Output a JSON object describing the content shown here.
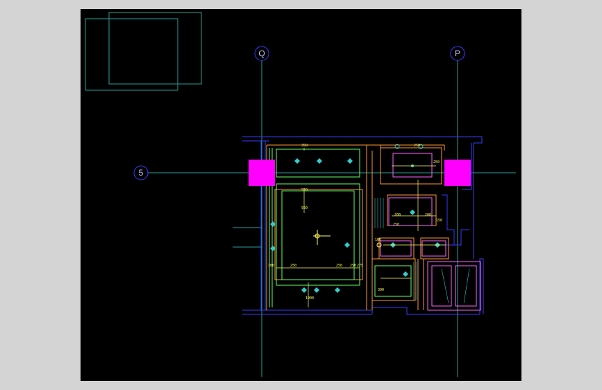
{
  "grid_labels": {
    "q": "Q",
    "p": "P",
    "row5": "5"
  },
  "dimensions": {
    "top_350": "350",
    "top_250a": "250",
    "top_250b": "250",
    "side_550": "550",
    "side_950": "950",
    "bot_300": "300",
    "bot_250a": "250",
    "bot_250b": "250",
    "bot_250c": "250",
    "bot_275": "275",
    "bot_1000": "1000",
    "r_200a": "200",
    "r_200b": "200",
    "r_250": "250",
    "r_150": "150",
    "r_100": "100",
    "r_300": "300"
  },
  "colors": {
    "background": "#000000",
    "grid_line": "#2aa198",
    "bubble": "#3a3aff",
    "column": "#ff00ff",
    "wall_outer": "#3a3aff",
    "wall_inner": "#ff9933",
    "ceiling_green": "#66ff66",
    "fixture": "#33cccc",
    "dimension": "#ffff66",
    "cabinet": "#ff66ff"
  }
}
